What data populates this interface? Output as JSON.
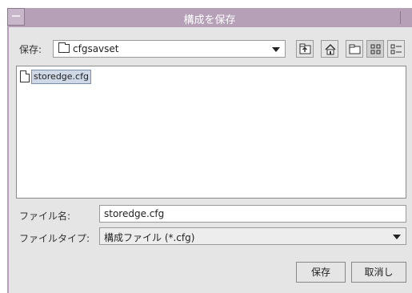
{
  "window": {
    "title": "構成を保存"
  },
  "lookin": {
    "label": "保存:",
    "value": "cfgsavset"
  },
  "toolbar": {
    "icons": [
      "up-one-level-icon",
      "home-icon",
      "new-folder-icon",
      "list-view-icon",
      "details-view-icon"
    ]
  },
  "files": [
    {
      "name": "storedge.cfg",
      "selected": true
    }
  ],
  "filename": {
    "label": "ファイル名:",
    "value": "storedge.cfg"
  },
  "filetype": {
    "label": "ファイルタイプ:",
    "value": "構成ファイル (*.cfg)"
  },
  "buttons": {
    "save": "保存",
    "cancel": "取消し"
  },
  "colors": {
    "titlebar": "#b6a0b8",
    "selection": "#cfd8e6"
  }
}
